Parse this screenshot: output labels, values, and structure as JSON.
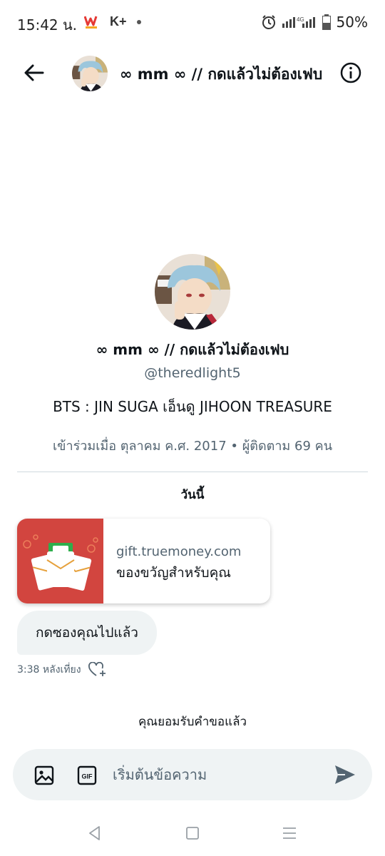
{
  "status_bar": {
    "time": "15:42 น.",
    "app_icons": [
      "wongnai-app-icon",
      "kplus-app-icon"
    ],
    "kplus_label": "K+",
    "network": "4G",
    "battery": "50%"
  },
  "header": {
    "title": "∞ mm ∞ // กดแล้วไม่ต้องเฟบ",
    "back_icon": "arrow-left-icon",
    "info_icon": "info-icon"
  },
  "profile": {
    "name": "∞ mm ∞ // กดแล้วไม่ต้องเฟบ",
    "handle": "@theredlight5",
    "bio": "BTS : JIN SUGA เอ็นดู JIHOON TREASURE",
    "meta": "เข้าร่วมเมื่อ ตุลาคม ค.ศ. 2017 • ผู้ติดตาม 69 คน"
  },
  "conversation": {
    "day_label": "วันนี้",
    "card": {
      "domain": "gift.truemoney.com",
      "description": "ของขวัญสำหรับคุณ",
      "bg_color": "#d2453f"
    },
    "message": {
      "text": "กดซองคุณไปแล้ว",
      "time": "3:38 หลังเที่ยง",
      "react_icon": "heart-plus-icon"
    },
    "accepted_notice": "คุณยอมรับคำขอแล้ว"
  },
  "composer": {
    "placeholder": "เริ่มต้นข้อความ",
    "image_icon": "image-icon",
    "gif_label": "GIF",
    "send_icon": "send-icon"
  },
  "nav": {
    "icons": [
      "back-triangle-icon",
      "home-square-icon",
      "recents-lines-icon"
    ]
  },
  "colors": {
    "accent": "#1d9bf0",
    "secondary_text": "#536471",
    "bubble_bg": "#eff3f4",
    "card_red": "#d2453f"
  }
}
